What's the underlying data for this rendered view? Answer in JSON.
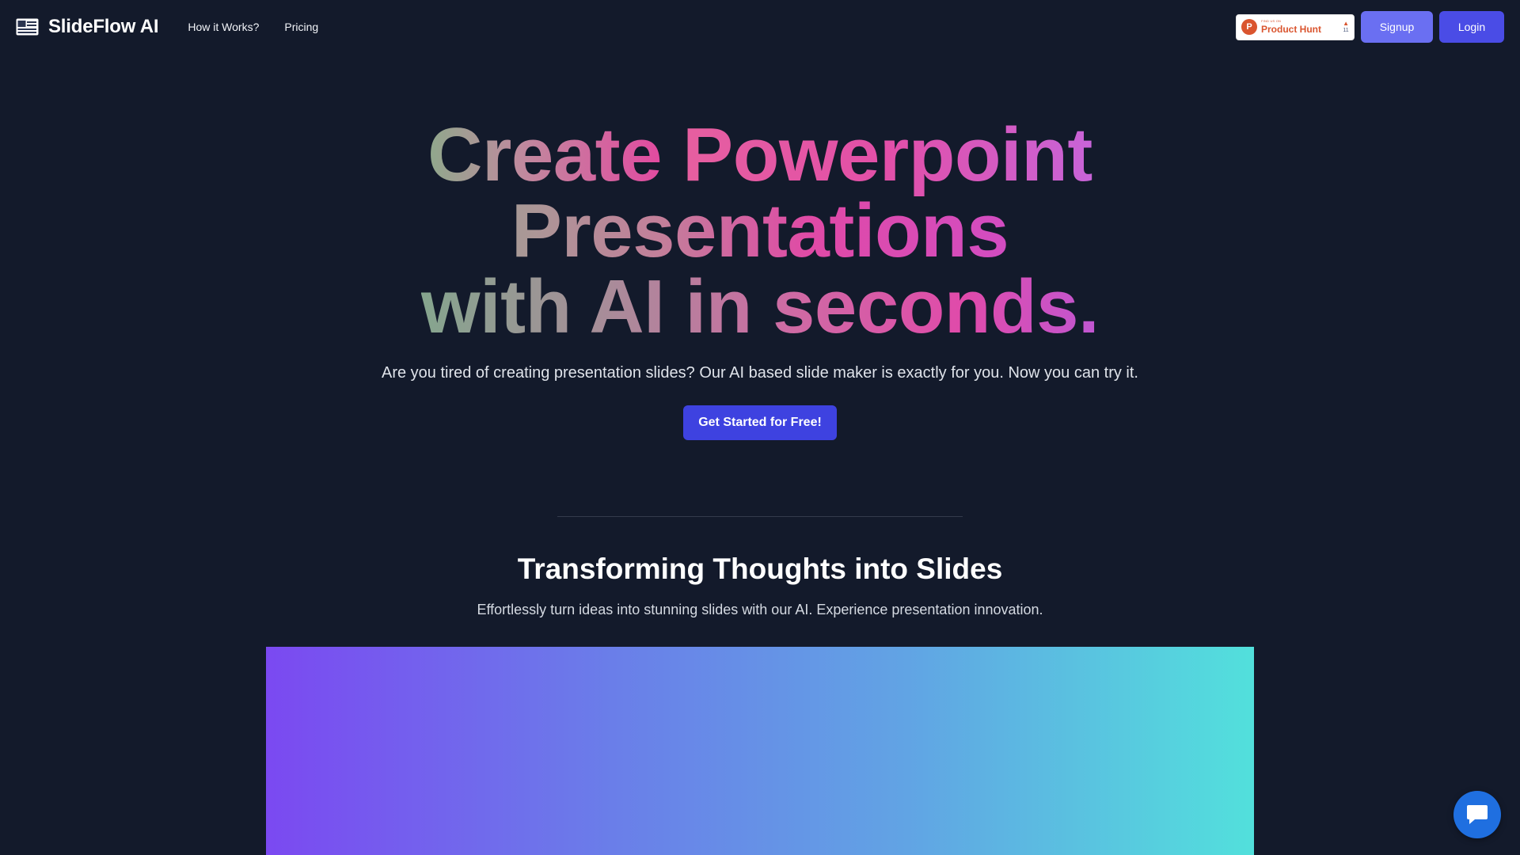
{
  "brand": {
    "name": "SlideFlow AI",
    "logo_icon": "slides-logo-icon"
  },
  "nav": {
    "links": [
      "How it Works?",
      "Pricing"
    ]
  },
  "product_hunt": {
    "small_label": "FIND US ON",
    "name": "Product Hunt",
    "votes": "11"
  },
  "auth": {
    "signup_label": "Signup",
    "login_label": "Login"
  },
  "hero": {
    "title_parts": {
      "create": "Create",
      "powerpoint": "Powerpoint",
      "presentations": "Presentations",
      "with_ai": "with AI in seconds."
    },
    "subtitle": "Are you tired of creating presentation slides? Our AI based slide maker is exactly for you. Now you can try it.",
    "cta_label": "Get Started for Free!"
  },
  "section": {
    "title": "Transforming Thoughts into Slides",
    "subtitle": "Effortlessly turn ideas into stunning slides with our AI. Experience presentation innovation."
  },
  "chat": {
    "icon": "chat-bubble-icon"
  },
  "colors": {
    "background": "#131a2b",
    "signup": "#6a6ff2",
    "login": "#4a4ce6",
    "cta": "#3e42e0",
    "chat": "#1f6fe0",
    "product_hunt": "#da552f"
  }
}
